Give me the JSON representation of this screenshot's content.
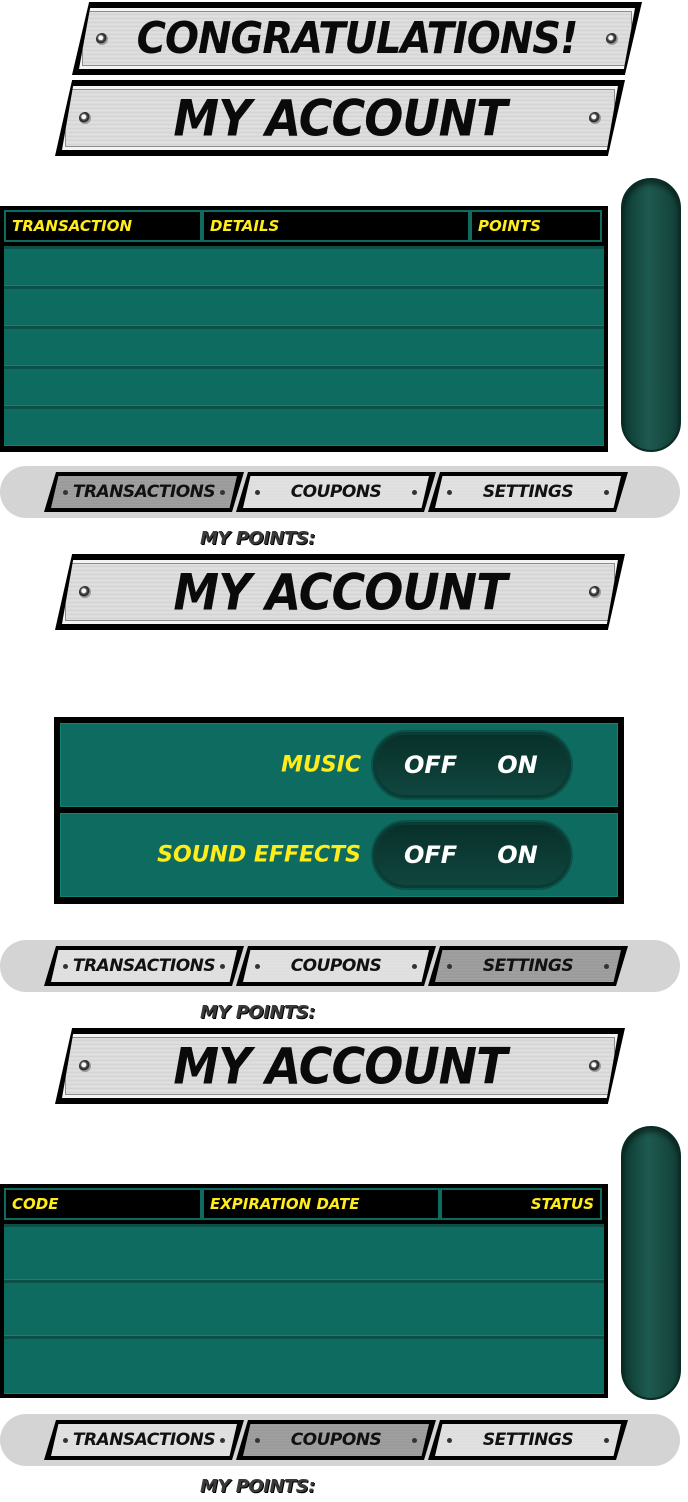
{
  "banner": {
    "title": "CONGRATULATIONS!"
  },
  "screens": [
    {
      "title": "MY ACCOUNT",
      "table": {
        "columns": [
          "TRANSACTION",
          "DETAILS",
          "POINTS"
        ],
        "rows": 5
      },
      "tabs": [
        "TRANSACTIONS",
        "COUPONS",
        "SETTINGS"
      ],
      "active_tab": "TRANSACTIONS",
      "points_label": "MY POINTS:"
    },
    {
      "title": "MY ACCOUNT",
      "settings": [
        {
          "label": "MUSIC",
          "off": "OFF",
          "on": "ON"
        },
        {
          "label": "SOUND EFFECTS",
          "off": "OFF",
          "on": "ON"
        }
      ],
      "tabs": [
        "TRANSACTIONS",
        "COUPONS",
        "SETTINGS"
      ],
      "active_tab": "SETTINGS",
      "points_label": "MY POINTS:"
    },
    {
      "title": "MY ACCOUNT",
      "table": {
        "columns": [
          "CODE",
          "EXPIRATION DATE",
          "STATUS"
        ],
        "rows": 3
      },
      "tabs": [
        "TRANSACTIONS",
        "COUPONS",
        "SETTINGS"
      ],
      "active_tab": "COUPONS",
      "points_label": "MY POINTS:"
    }
  ],
  "colors": {
    "panel": "#0e6b60",
    "header_text": "#ffec1a",
    "scrollbar": "#1e5a50"
  }
}
